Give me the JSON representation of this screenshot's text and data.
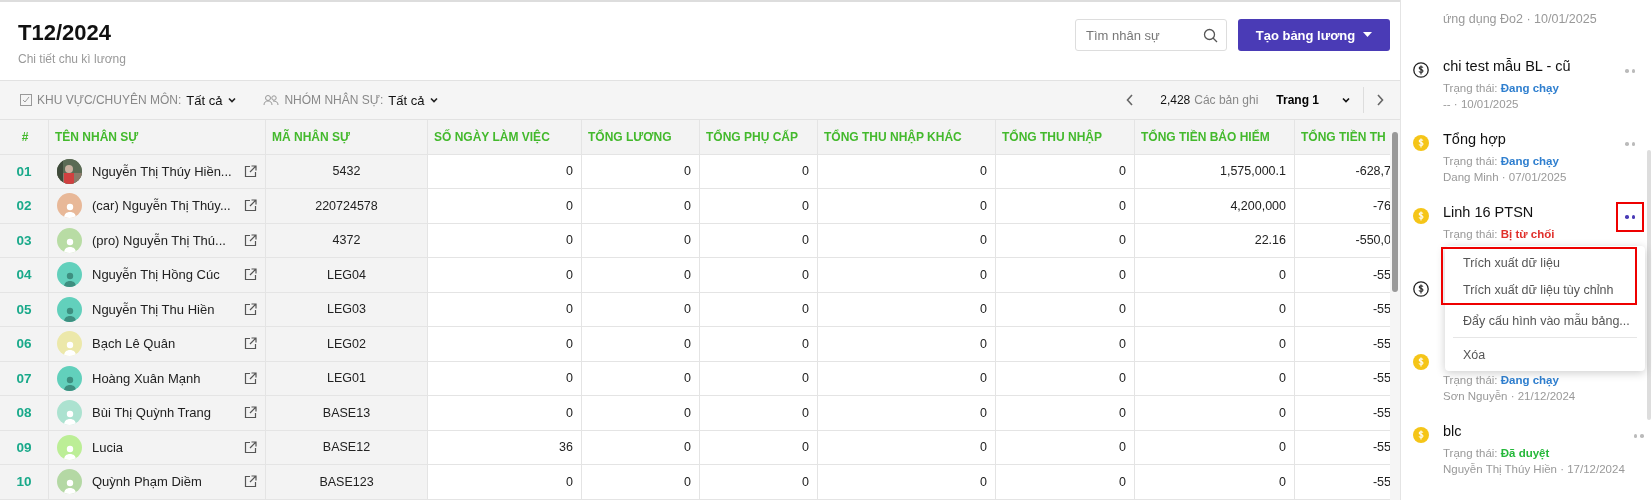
{
  "header": {
    "title": "T12/2024",
    "subtitle": "Chi tiết chu kì lương",
    "search": {
      "placeholder": "Tìm nhân sự"
    },
    "create_button": "Tạo bảng lương"
  },
  "filters": [
    {
      "kind": "area",
      "label": "KHU VỰC/CHUYÊN MÔN:",
      "value": "Tất cả"
    },
    {
      "kind": "group",
      "label": "NHÓM NHÂN SỰ:",
      "value": "Tất cả"
    }
  ],
  "pagination": {
    "count": "2,428",
    "count_label": "Các bản ghi",
    "page": "Trang 1"
  },
  "table": {
    "columns": [
      "#",
      "TÊN NHÂN SỰ",
      "MÃ NHÂN SỰ",
      "SỐ NGÀY LÀM VIỆC",
      "TỔNG LƯƠNG",
      "TỔNG PHỤ CẤP",
      "TỔNG THU NHẬP KHÁC",
      "TỔNG THU NHẬP",
      "TỔNG TIỀN BẢO HIỂM",
      "TỔNG TIỀN TH"
    ],
    "rows": [
      {
        "no": "01",
        "name": "Nguyễn Thị Thúy Hiền...",
        "code": "5432",
        "values": [
          "0",
          "0",
          "0",
          "0",
          "0",
          "1,575,000.1",
          "-628,7"
        ]
      },
      {
        "no": "02",
        "name": "(car) Nguyễn Thị Thúy...",
        "avatar": {
          "kind": "light-figure",
          "color": "#e8b898"
        },
        "code": "220724578",
        "values": [
          "0",
          "0",
          "0",
          "0",
          "0",
          "4,200,000",
          "-76"
        ]
      },
      {
        "no": "03",
        "name": "(pro) Nguyễn Thị Thú...",
        "avatar": {
          "kind": "light-figure",
          "color": "#b8dca4"
        },
        "code": "4372",
        "values": [
          "0",
          "0",
          "0",
          "0",
          "0",
          "22.16",
          "-550,0"
        ]
      },
      {
        "no": "04",
        "name": "Nguyễn Thị Hồng Cúc",
        "avatar": {
          "kind": "dark-figure",
          "color": "#62d0bc"
        },
        "code": "LEG04",
        "values": [
          "0",
          "0",
          "0",
          "0",
          "0",
          "0",
          "-55"
        ]
      },
      {
        "no": "05",
        "name": "Nguyễn Thị Thu Hiền",
        "avatar": {
          "kind": "dark-figure",
          "color": "#62d0bc"
        },
        "code": "LEG03",
        "values": [
          "0",
          "0",
          "0",
          "0",
          "0",
          "0",
          "-55"
        ]
      },
      {
        "no": "06",
        "name": "Bạch Lê Quân",
        "avatar": {
          "kind": "light-figure",
          "color": "#ece8aa"
        },
        "code": "LEG02",
        "values": [
          "0",
          "0",
          "0",
          "0",
          "0",
          "0",
          "-55"
        ]
      },
      {
        "no": "07",
        "name": "Hoàng Xuân Mạnh",
        "avatar": {
          "kind": "dark-figure",
          "color": "#62d0bc"
        },
        "code": "LEG01",
        "values": [
          "0",
          "0",
          "0",
          "0",
          "0",
          "0",
          "-55"
        ]
      },
      {
        "no": "08",
        "name": "Bùi Thị Quỳnh Trang",
        "avatar": {
          "kind": "light-figure",
          "color": "#ace2d0"
        },
        "code": "BASE13",
        "values": [
          "0",
          "0",
          "0",
          "0",
          "0",
          "0",
          "-55"
        ]
      },
      {
        "no": "09",
        "name": "Lucia",
        "avatar": {
          "kind": "light-figure",
          "color": "#bcee96"
        },
        "code": "BASE12",
        "values": [
          "36",
          "0",
          "0",
          "0",
          "0",
          "0",
          "-55"
        ]
      },
      {
        "no": "10",
        "name": "Quỳnh Phạm Diềm",
        "avatar": {
          "kind": "light-figure",
          "color": "#b4d8a4"
        },
        "code": "BASE123",
        "values": [
          "0",
          "0",
          "0",
          "0",
          "0",
          "0",
          "-55"
        ]
      }
    ]
  },
  "cycles": [
    {
      "kind": "note",
      "lines": [
        "ứng dụng Đo2 · 10/01/2025"
      ]
    },
    {
      "kind": "outline",
      "title": "chi test mẫu BL - cũ",
      "status_label": "Trạng thái:",
      "status": "Đang chạy",
      "color": "#2f7fcf",
      "meta": "-- · 10/01/2025",
      "menu_open": false
    },
    {
      "kind": "coin",
      "title": "Tổng hợp",
      "status_label": "Trạng thái:",
      "status": "Đang chạy",
      "color": "#2f7fcf",
      "meta": "Dang Minh · 07/01/2025",
      "menu_open": false
    },
    {
      "kind": "coin",
      "title": "Linh 16 PTSN",
      "status_label": "Trạng thái:",
      "status": "Bị từ chối",
      "color": "#e0302b",
      "menu_open": true
    },
    {
      "kind": "outline"
    },
    {
      "kind": "coin",
      "status_label": "Trạng thái:",
      "status": "Đang chạy",
      "color": "#2f7fcf",
      "meta": "Sơn Nguyễn · 21/12/2024"
    },
    {
      "kind": "coin",
      "title": "blc",
      "status_label": "Trạng thái:",
      "status": "Đã duyệt",
      "color": "#25b83a",
      "meta": "Nguyễn Thị Thúy Hiền · 17/12/2024",
      "menu_open": false
    }
  ],
  "menu": {
    "items": [
      {
        "label": "Trích xuất dữ liệu",
        "highlighted": true
      },
      {
        "label": "Trích xuất dữ liệu tùy chỉnh",
        "highlighted": true
      },
      {
        "label": "Đẩy cấu hình vào mẫu bảng...",
        "highlighted": false
      },
      {
        "label": "Xóa",
        "highlighted": false,
        "divider_before": true
      }
    ]
  }
}
